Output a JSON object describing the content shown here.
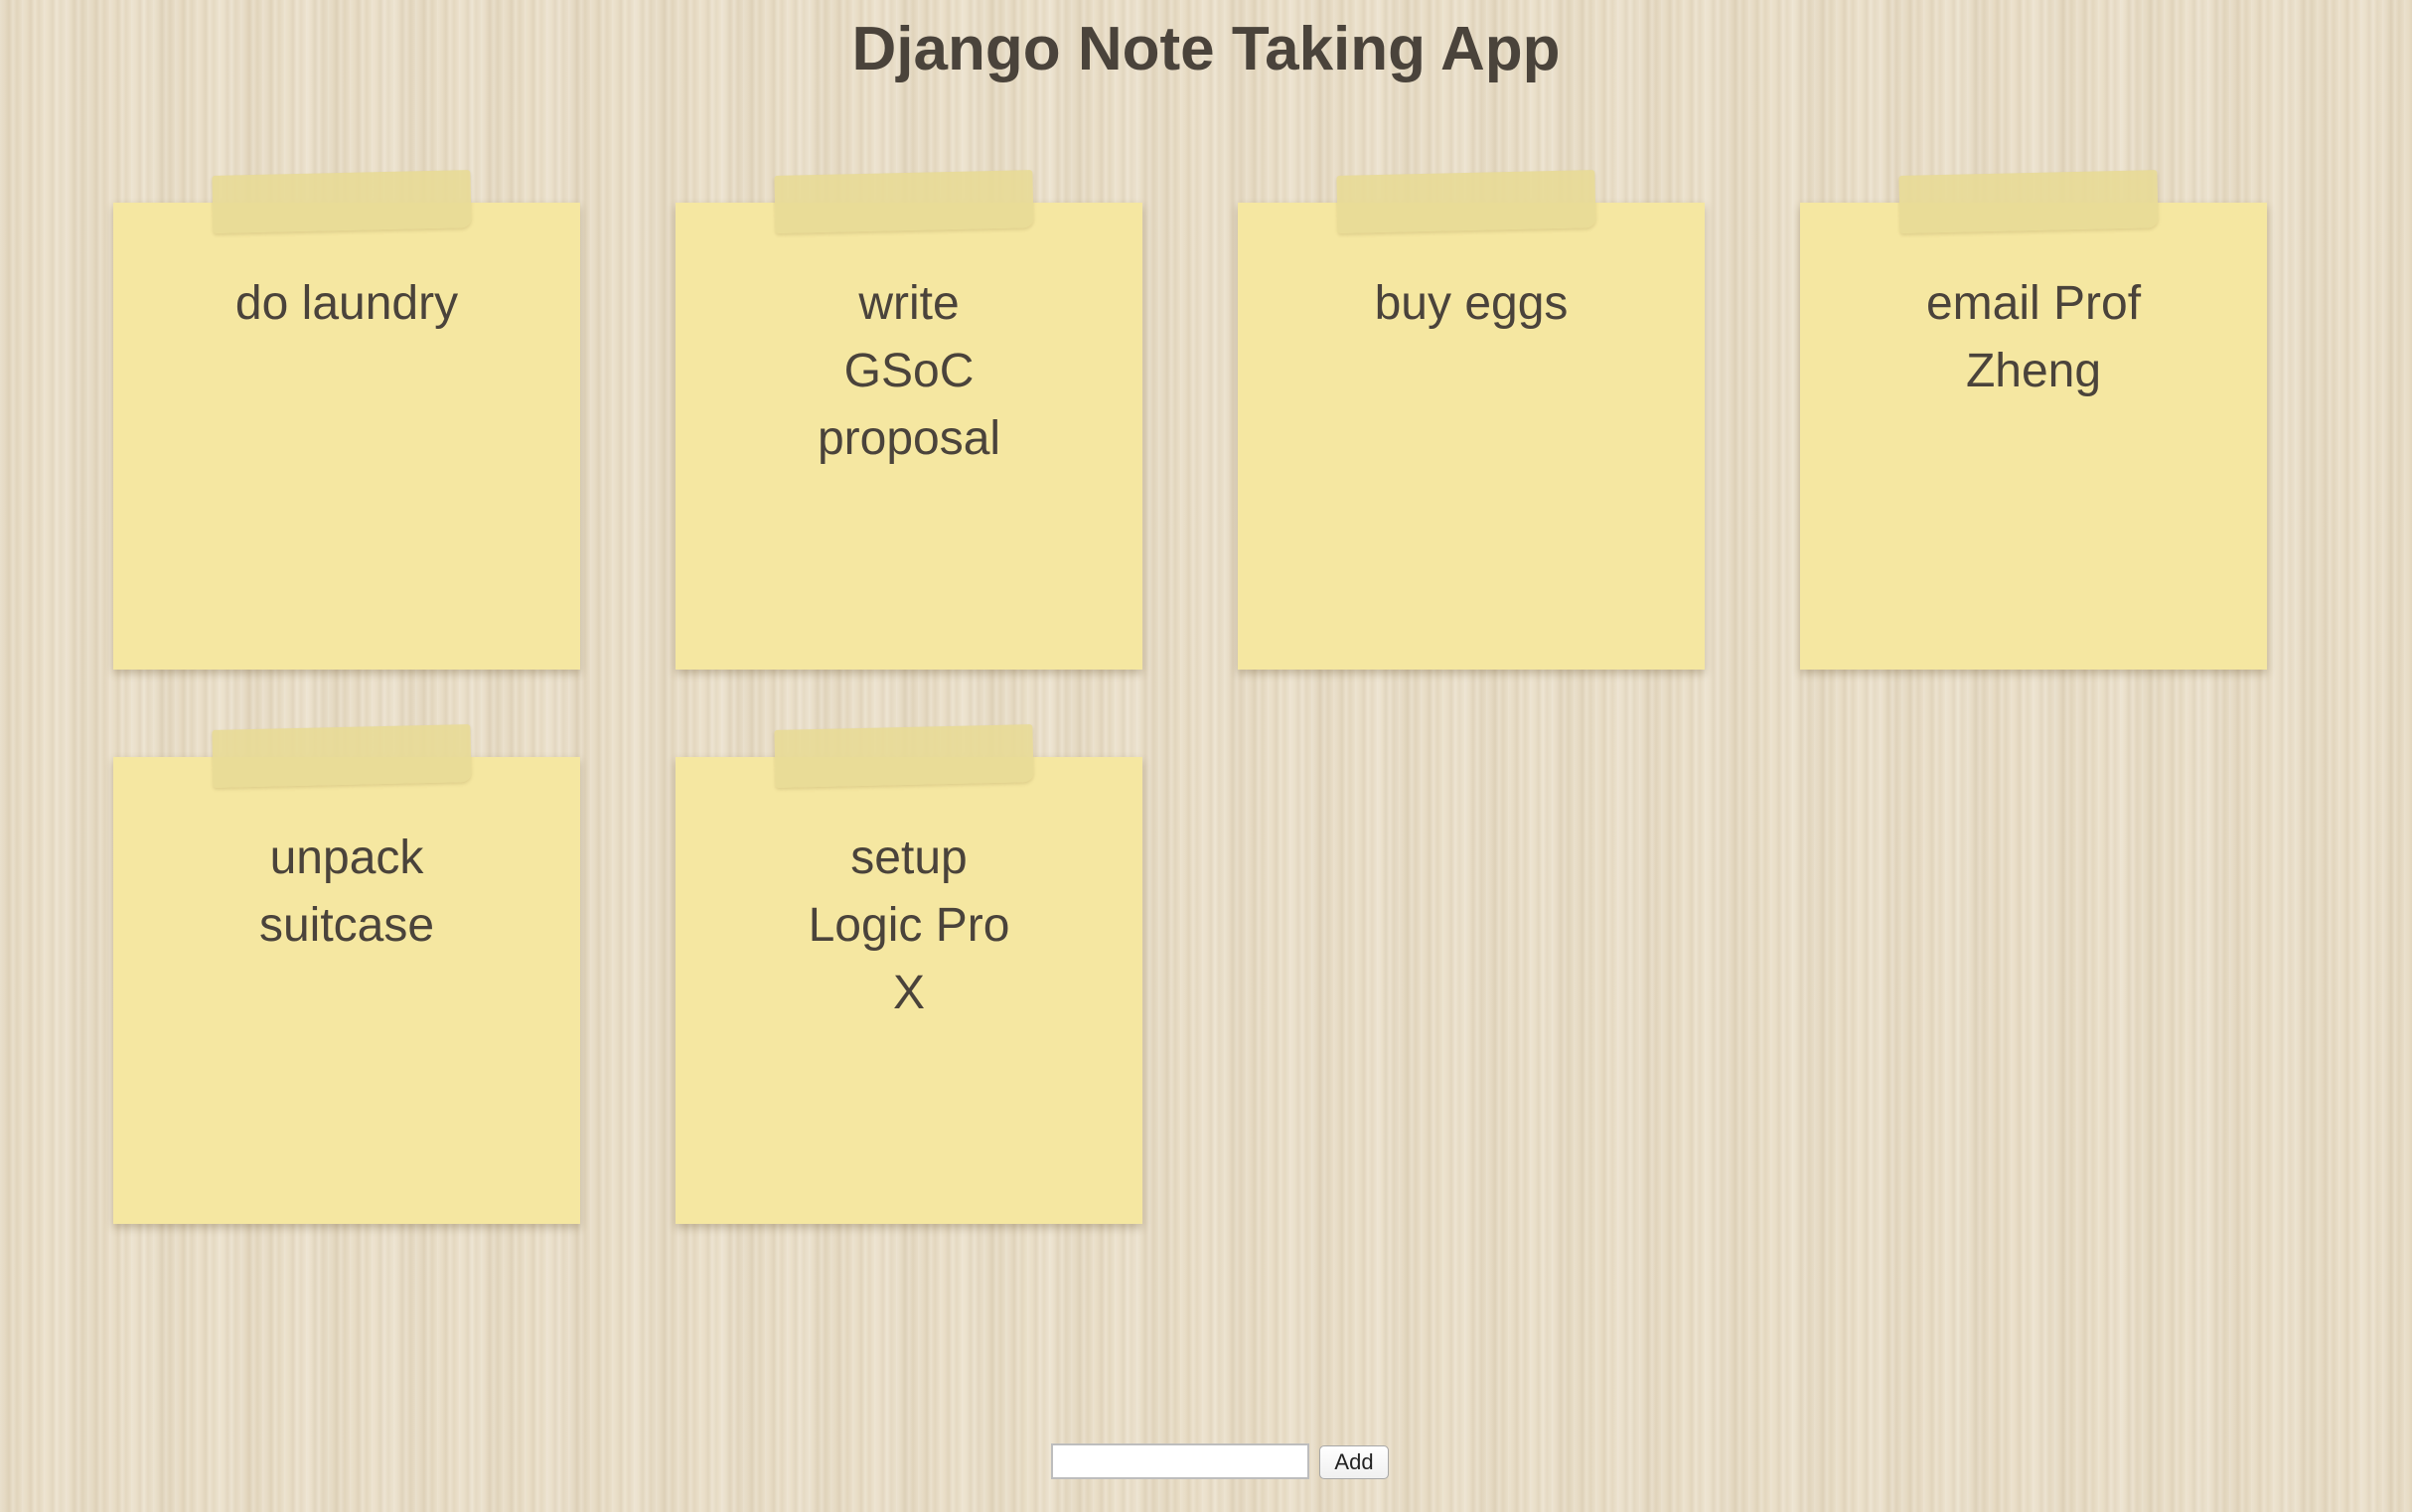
{
  "header": {
    "title": "Django Note Taking App"
  },
  "notes": [
    {
      "text": "do laundry"
    },
    {
      "text": "write GSoC proposal"
    },
    {
      "text": "buy eggs"
    },
    {
      "text": "email Prof Zheng"
    },
    {
      "text": "unpack suitcase"
    },
    {
      "text": "setup Logic Pro X"
    }
  ],
  "form": {
    "input_value": "",
    "add_label": "Add"
  },
  "colors": {
    "note": "#f5e7a1",
    "text": "#4a433b",
    "background": "#e8dcc4"
  }
}
